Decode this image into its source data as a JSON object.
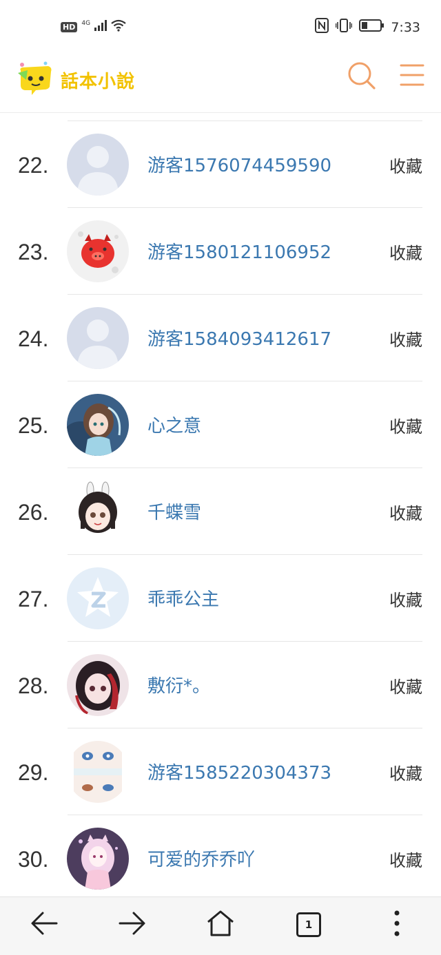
{
  "status_bar": {
    "hd": "HD",
    "network": "4G",
    "time": "7:33",
    "icons": [
      "signal-icon",
      "wifi-icon",
      "nfc-icon",
      "vibrate-icon",
      "battery-icon"
    ]
  },
  "header": {
    "logo_text": "話本小說",
    "logo_color": "#f2c200",
    "accent_color": "#f0a068",
    "icons": [
      "search-icon",
      "menu-icon"
    ]
  },
  "list": {
    "fav_label": "收藏",
    "name_color": "#3b78b0",
    "items": [
      {
        "rank": "22.",
        "name": "游客1576074459590",
        "avatar": "default-avatar"
      },
      {
        "rank": "23.",
        "name": "游客1580121106952",
        "avatar": "pig-avatar"
      },
      {
        "rank": "24.",
        "name": "游客1584093412617",
        "avatar": "default-avatar"
      },
      {
        "rank": "25.",
        "name": "心之意",
        "avatar": "anime-girl-avatar"
      },
      {
        "rank": "26.",
        "name": "千蝶雪",
        "avatar": "chibi-girl-avatar"
      },
      {
        "rank": "27.",
        "name": "乖乖公主",
        "avatar": "qzone-avatar"
      },
      {
        "rank": "28.",
        "name": "敷衍*。",
        "avatar": "red-hair-girl-avatar"
      },
      {
        "rank": "29.",
        "name": "游客1585220304373",
        "avatar": "eyes-avatar"
      },
      {
        "rank": "30.",
        "name": "可爱的乔乔吖",
        "avatar": "pink-girl-avatar"
      }
    ]
  },
  "bottom_nav": {
    "tab_count": "1",
    "icons": [
      "back-arrow-icon",
      "forward-arrow-icon",
      "home-icon",
      "tabs-icon",
      "more-vertical-icon"
    ]
  }
}
